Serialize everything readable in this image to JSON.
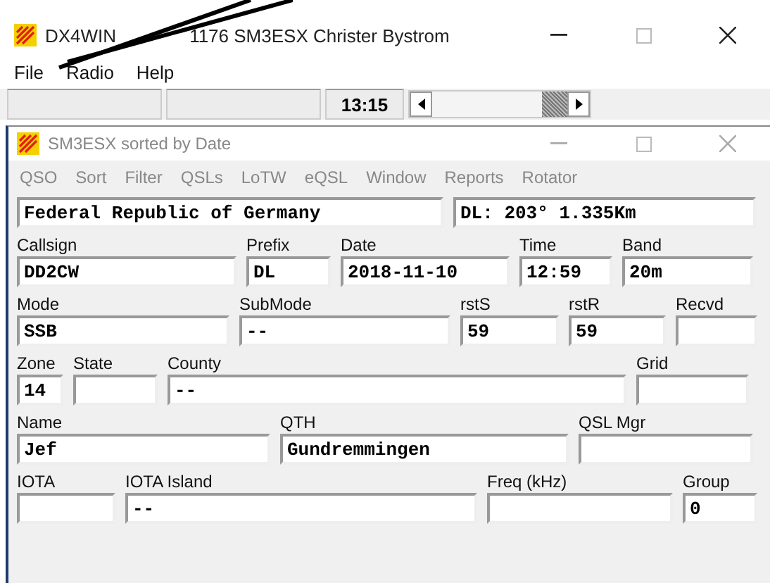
{
  "window": {
    "title_parts": [
      "DX4WIN",
      "1176 SM3ESX Christer Bystrom"
    ]
  },
  "menu": [
    "File",
    "Radio",
    "Help"
  ],
  "status_bar": {
    "time": "13:15"
  },
  "log_window": {
    "title": "SM3ESX sorted by Date",
    "menu": [
      "QSO",
      "Sort",
      "Filter",
      "QSLs",
      "LoTW",
      "eQSL",
      "Window",
      "Reports",
      "Rotator"
    ],
    "country": "Federal Republic of Germany",
    "bearing": "DL: 203° 1.335Km",
    "rows": [
      [
        {
          "label": "Callsign",
          "value": "DD2CW"
        },
        {
          "label": "Prefix",
          "value": "DL"
        },
        {
          "label": "Date",
          "value": "2018-11-10"
        },
        {
          "label": "Time",
          "value": "12:59"
        },
        {
          "label": "Band",
          "value": "20m"
        }
      ],
      [
        {
          "label": "Mode",
          "value": "SSB"
        },
        {
          "label": "SubMode",
          "value": "--"
        },
        {
          "label": "rstS",
          "value": "59"
        },
        {
          "label": "rstR",
          "value": "59"
        },
        {
          "label": "Recvd"
        }
      ],
      [
        {
          "label": "Zone",
          "value": "14"
        },
        {
          "label": "State"
        },
        {
          "label": "County",
          "value": "--"
        },
        {
          "label": "Grid"
        }
      ],
      [
        {
          "label": "Name",
          "value": "Jef"
        },
        {
          "label": "QTH",
          "value": "Gundremmingen"
        },
        {
          "label": "QSL Mgr"
        }
      ],
      [
        {
          "label": "IOTA"
        },
        {
          "label": "IOTA Island",
          "value": "--"
        },
        {
          "label": "Freq (kHz)"
        },
        {
          "label": "Group",
          "value": "0"
        }
      ]
    ]
  }
}
